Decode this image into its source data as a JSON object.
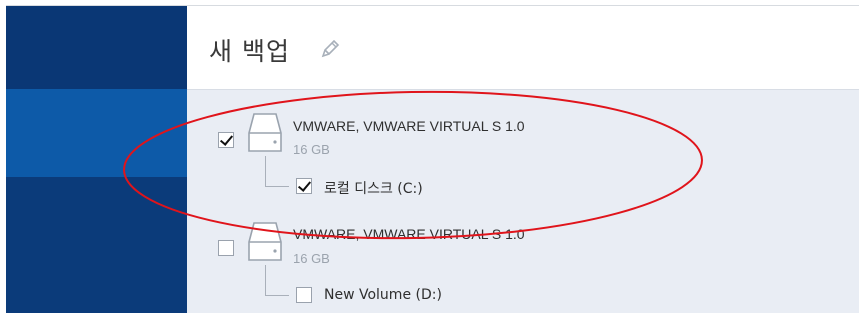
{
  "header": {
    "title": "새 백업",
    "edit_icon": "pencil-icon"
  },
  "disks": [
    {
      "name": "VMWARE, VMWARE VIRTUAL S 1.0",
      "size": "16 GB",
      "checked": true,
      "volumes": [
        {
          "label": "로컬 디스크 (C:)",
          "checked": true
        }
      ]
    },
    {
      "name": "VMWARE, VMWARE VIRTUAL S 1.0",
      "size": "16 GB",
      "checked": false,
      "volumes": [
        {
          "label": "New Volume (D:)",
          "checked": false
        }
      ]
    }
  ],
  "colors": {
    "sidebar": "#0b3b7a",
    "sidebar_selected": "#0d5aa8",
    "content_bg": "#e9edf4",
    "annotation": "#e0141b"
  }
}
